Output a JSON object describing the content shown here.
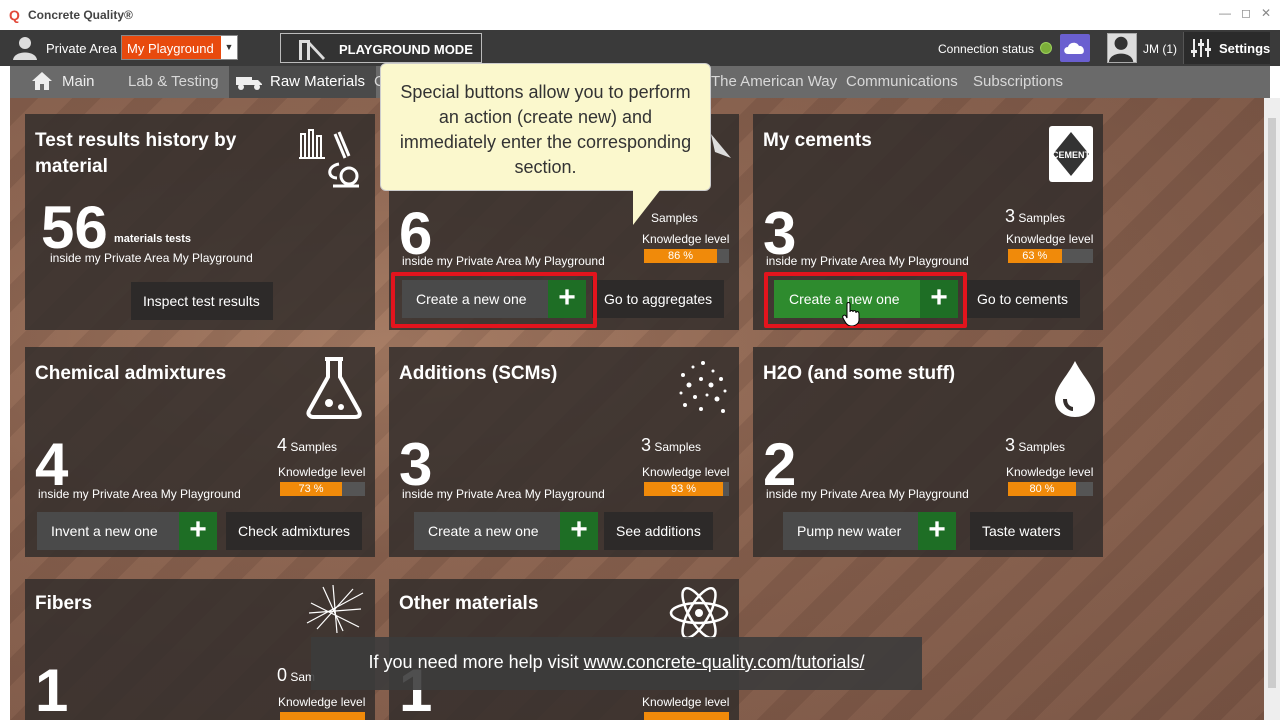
{
  "app": {
    "title": "Concrete Quality®"
  },
  "topbar": {
    "private_area_label": "Private Area",
    "playground_value": "My Playground",
    "playground_mode_label": "PLAYGROUND MODE",
    "connection_label": "Connection status",
    "user_label": "JM (1)",
    "settings_label": "Settings"
  },
  "nav": {
    "main": "Main",
    "lab": "Lab & Testing",
    "raw": "Raw Materials",
    "partial": "C",
    "american": "The American Way",
    "communications": "Communications",
    "subscriptions": "Subscriptions"
  },
  "tooltip": {
    "text": "Special buttons allow you to perform an action (create new) and immediately enter the corresponding section."
  },
  "tiles": {
    "history": {
      "title": "Test results history by material",
      "count": "56",
      "count_label": "materials tests",
      "inside": "inside my Private Area My Playground",
      "button": "Inspect test results"
    },
    "aggregates": {
      "count": "6",
      "samples_count": "",
      "samples_label": "Samples",
      "kl_label": "Knowledge level",
      "kl_value": "86 %",
      "kl_pct": 86,
      "inside": "inside my Private Area My Playground",
      "create": "Create a new one",
      "go": "Go to aggregates"
    },
    "cements": {
      "title": "My cements",
      "count": "3",
      "samples_count": "3",
      "samples_label": "Samples",
      "kl_label": "Knowledge level",
      "kl_value": "63 %",
      "kl_pct": 63,
      "inside": "inside my Private Area My Playground",
      "create": "Create a new one",
      "go": "Go to cements"
    },
    "admixtures": {
      "title": "Chemical admixtures",
      "count": "4",
      "samples_count": "4",
      "samples_label": "Samples",
      "kl_label": "Knowledge level",
      "kl_value": "73 %",
      "kl_pct": 73,
      "inside": "inside my Private Area My Playground",
      "create": "Invent a new one",
      "go": "Check admixtures"
    },
    "additions": {
      "title": "Additions (SCMs)",
      "count": "3",
      "samples_count": "3",
      "samples_label": "Samples",
      "kl_label": "Knowledge level",
      "kl_value": "93 %",
      "kl_pct": 93,
      "inside": "inside my Private Area My Playground",
      "create": "Create a new one",
      "go": "See additions"
    },
    "water": {
      "title": "H2O (and some stuff)",
      "count": "2",
      "samples_count": "3",
      "samples_label": "Samples",
      "kl_label": "Knowledge level",
      "kl_value": "80 %",
      "kl_pct": 80,
      "inside": "inside my Private Area My Playground",
      "create": "Pump new water",
      "go": "Taste waters"
    },
    "fibers": {
      "title": "Fibers",
      "count": "1",
      "samples_count": "0",
      "samples_label": "Sam",
      "kl_label": "Knowledge level"
    },
    "other": {
      "title": "Other materials",
      "count": "1",
      "kl_label": "Knowledge level"
    }
  },
  "helpbar": {
    "prefix": "If you need more help visit ",
    "link": "www.concrete-quality.com/tutorials/"
  }
}
